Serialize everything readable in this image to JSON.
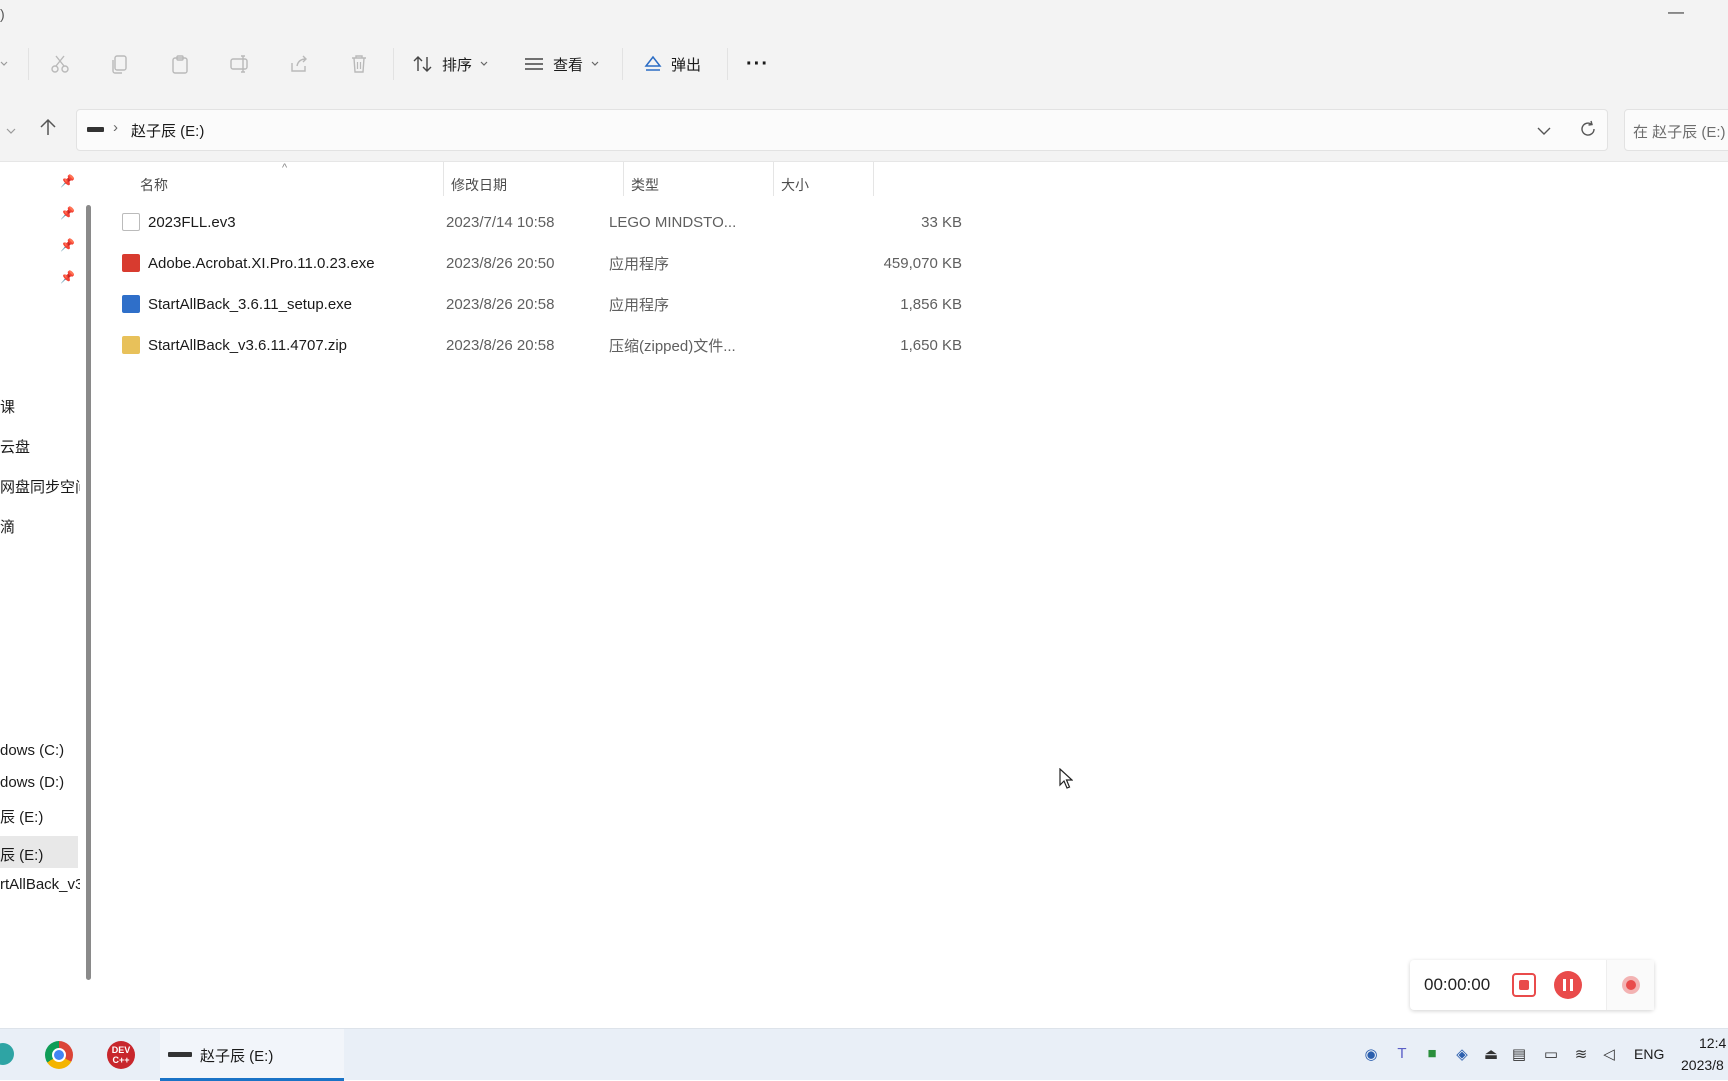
{
  "titlebar": {
    "left_char": ")",
    "minimize": "—"
  },
  "toolbar": {
    "sort_label": "排序",
    "view_label": "查看",
    "eject_label": "弹出",
    "more_label": "···"
  },
  "address": {
    "drive_label": "赵子辰 (E:)",
    "search_placeholder": "在 赵子辰 (E:)"
  },
  "sidebar": {
    "items": [
      {
        "label": "课"
      },
      {
        "label": "云盘"
      },
      {
        "label": "网盘同步空间"
      },
      {
        "label": "滴"
      },
      {
        "label": "dows (C:)"
      },
      {
        "label": "dows (D:)"
      },
      {
        "label": "辰 (E:)"
      },
      {
        "label": "辰 (E:)"
      },
      {
        "label": "rtAllBack_v3"
      }
    ]
  },
  "columns": {
    "name": "名称",
    "modified": "修改日期",
    "type": "类型",
    "size": "大小"
  },
  "files": [
    {
      "name": "2023FLL.ev3",
      "modified": "2023/7/14 10:58",
      "type": "LEGO MINDSTO...",
      "size": "33 KB",
      "icon": "ev3-file-icon",
      "color": "#ffffff"
    },
    {
      "name": "Adobe.Acrobat.XI.Pro.11.0.23.exe",
      "modified": "2023/8/26 20:50",
      "type": "应用程序",
      "size": "459,070 KB",
      "icon": "acrobat-exe-icon",
      "color": "#d83b2f"
    },
    {
      "name": "StartAllBack_3.6.11_setup.exe",
      "modified": "2023/8/26 20:58",
      "type": "应用程序",
      "size": "1,856 KB",
      "icon": "installer-exe-icon",
      "color": "#2f6fc9"
    },
    {
      "name": "StartAllBack_v3.6.11.4707.zip",
      "modified": "2023/8/26 20:58",
      "type": "压缩(zipped)文件...",
      "size": "1,650 KB",
      "icon": "zip-folder-icon",
      "color": "#e8c15a"
    }
  ],
  "recorder": {
    "time": "00:00:00"
  },
  "taskbar": {
    "explorer_label": "赵子辰 (E:)",
    "lang": "ENG",
    "clock_time": "12:4",
    "clock_date": "2023/8"
  }
}
